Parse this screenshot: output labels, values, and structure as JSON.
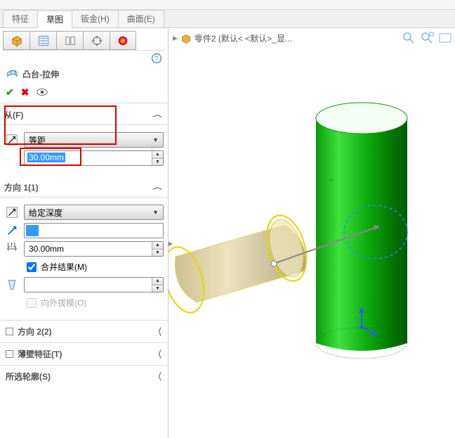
{
  "tabs": {
    "feature": "特征",
    "sketch": "草图",
    "sheetmetal": "钣金(H)",
    "surface": "曲面(E)"
  },
  "feature": {
    "title": "凸台-拉伸"
  },
  "from": {
    "label": "从(F)",
    "option": "等距",
    "offset": "30.00mm"
  },
  "dir1": {
    "label": "方向 1(1)",
    "option": "给定深度",
    "depth": "30.00mm",
    "merge": "合并结果(M)",
    "draft": "向外拔模(O)"
  },
  "dir2": {
    "label": "方向 2(2)"
  },
  "thin": {
    "label": "薄壁特征(T)"
  },
  "contour": {
    "label": "所选轮廓(S)"
  },
  "breadcrumb": {
    "part": "零件2  (默认< <默认>_显..."
  }
}
